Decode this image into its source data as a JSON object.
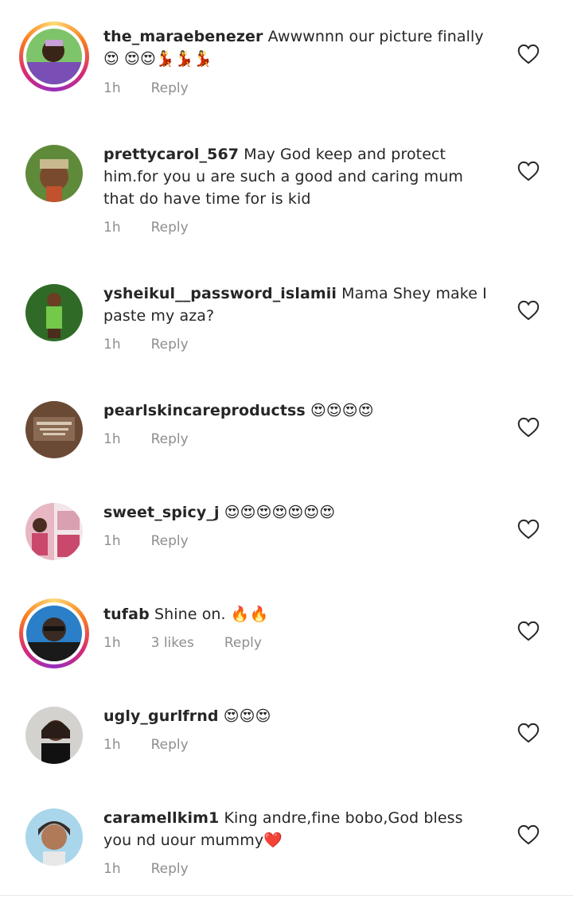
{
  "comments": [
    {
      "username": "the_maraebenezer",
      "text": "Awwwnnn our picture finally 😍 😍😍💃💃💃",
      "time": "1h",
      "likes": "",
      "reply": "Reply",
      "story_ring": true,
      "avatar_colors": [
        "#7a4fb5",
        "#3e7d3a"
      ]
    },
    {
      "username": "prettycarol_567",
      "text": "May God keep and protect him.for you u are such a good and caring mum that do have time for is kid",
      "time": "1h",
      "likes": "",
      "reply": "Reply",
      "story_ring": false,
      "avatar_colors": [
        "#5f8a3a",
        "#c0532d"
      ]
    },
    {
      "username": "ysheikul__password_islamii",
      "text": "Mama Shey make I paste my aza?",
      "time": "1h",
      "likes": "",
      "reply": "Reply",
      "story_ring": false,
      "avatar_colors": [
        "#3f8a2e",
        "#74c94a"
      ]
    },
    {
      "username": "pearlskincareproductss",
      "text": "😍😍😍😍",
      "time": "1h",
      "likes": "",
      "reply": "Reply",
      "story_ring": false,
      "avatar_colors": [
        "#6b4a35",
        "#d9c9b4"
      ]
    },
    {
      "username": "sweet_spicy_j",
      "text": "😍😍😍😍😍😍😍",
      "time": "1h",
      "likes": "",
      "reply": "Reply",
      "story_ring": false,
      "avatar_colors": [
        "#c9486b",
        "#e8b7c4"
      ]
    },
    {
      "username": "tufab",
      "text": "Shine on. 🔥🔥",
      "time": "1h",
      "likes": "3 likes",
      "reply": "Reply",
      "story_ring": true,
      "avatar_colors": [
        "#2a7fc8",
        "#3b2a22"
      ]
    },
    {
      "username": "ugly_gurlfrnd",
      "text": "😍😍😍",
      "time": "1h",
      "likes": "",
      "reply": "Reply",
      "story_ring": false,
      "avatar_colors": [
        "#d4d2cf",
        "#2a1d18"
      ]
    },
    {
      "username": "caramellkim1",
      "text": "King andre,fine bobo,God bless you nd uour mummy❤️",
      "time": "1h",
      "likes": "",
      "reply": "Reply",
      "story_ring": false,
      "avatar_colors": [
        "#a9d6ea",
        "#3a2a22"
      ]
    }
  ]
}
